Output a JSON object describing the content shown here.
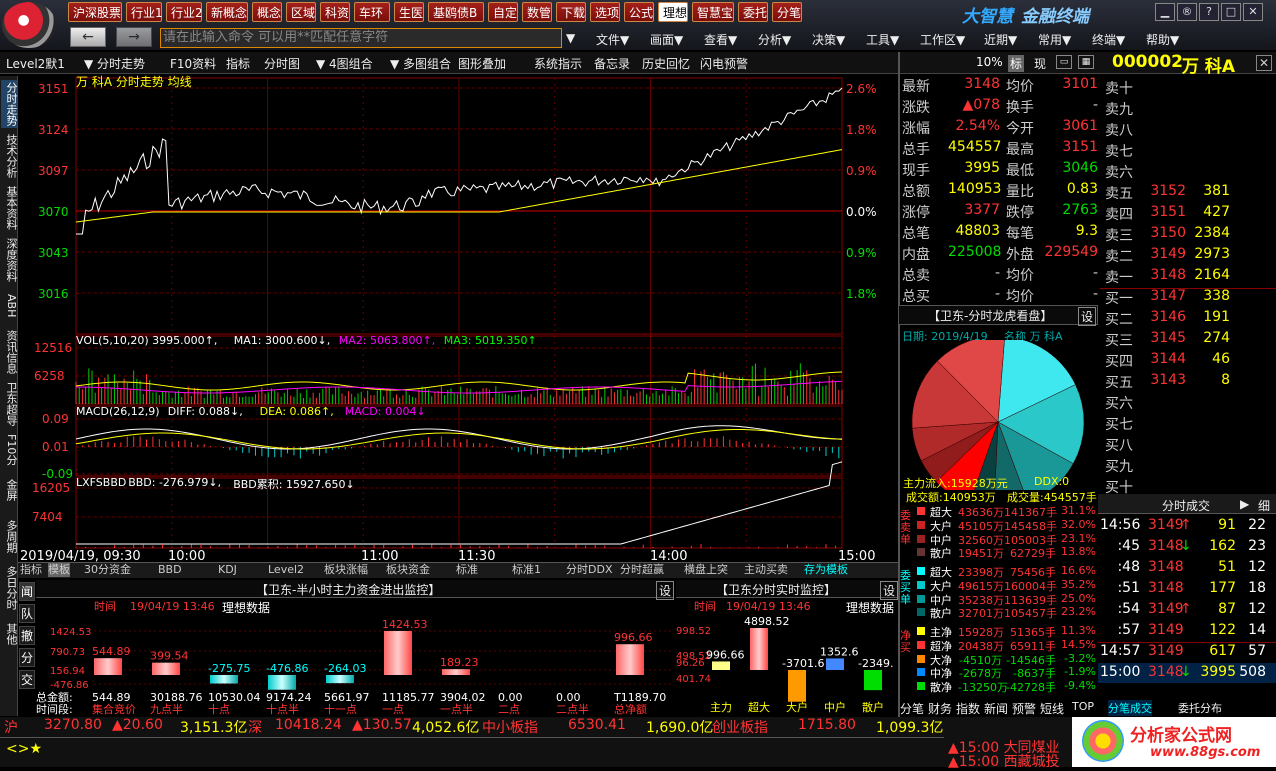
{
  "menu": {
    "tabs": [
      "沪深股票",
      "行业1",
      "行业2",
      "新概念",
      "概念",
      "区域",
      "科资",
      "车环",
      "生医",
      "基鸥债B",
      "自定",
      "数管",
      "下载",
      "选项",
      "公式",
      "理想",
      "智慧宝",
      "委托",
      "分笔"
    ],
    "selected": "理想",
    "brand": "大智慧",
    "brand2": "金融终端",
    "cmd_placeholder": "请在此输入命令   可以用**匹配任意字符",
    "menu2": [
      "文件▼",
      "画面▼",
      "查看▼",
      "分析▼",
      "决策▼",
      "工具▼",
      "工作区▼",
      "近期▼",
      "常用▼",
      "终端▼",
      "帮助▼"
    ],
    "back": "←",
    "fwd": "→"
  },
  "toolbar": [
    "Level2默1",
    "▼ 分时走势",
    "F10资料",
    "指标",
    "分时图",
    "▼ 4图组合",
    "▼ 多图组合",
    "图形叠加",
    "系统指示",
    "备忘录",
    "历史回忆",
    "闪电预警"
  ],
  "toolbar_right": {
    "pct": "10%",
    "a": "标",
    "b": "现"
  },
  "vtabs": [
    "分时走势",
    "技术分析",
    "基本资料",
    "深度资料",
    "ABH",
    "资讯信息",
    "卫东超导",
    "F10分",
    "金屏",
    "多周期",
    "多日分时",
    "其他"
  ],
  "chart": {
    "title": "万 科A 分时走势 均线",
    "y_left": [
      "3151",
      "3124",
      "3097",
      "3070",
      "3043",
      "3016"
    ],
    "y_right": [
      "2.6%",
      "1.8%",
      "0.9%",
      "0.0%",
      "0.9%",
      "1.8%"
    ],
    "vol_header": {
      "a": "VOL(5,10,20) 3995.000↑,",
      "b": "MA1: 3000.600↓,",
      "c": "MA2: 5063.800↑,",
      "d": "MA3: 5019.350↑"
    },
    "vol_y": [
      "12516",
      "6258"
    ],
    "macd_header": {
      "a": "MACD(26,12,9)",
      "b": "DIFF: 0.088↓,",
      "c": "DEA: 0.086↑,",
      "d": "MACD: 0.004↓"
    },
    "macd_y": [
      "0.09",
      "0.01",
      "-0.09"
    ],
    "lxf_header": {
      "a": "LXFSBBD",
      "b": "BBD: -276.979↓,",
      "c": "BBD累积: 15927.650↓"
    },
    "lxf_y": [
      "16205",
      "7404"
    ],
    "xtimes": [
      "2019/04/19, 09:30",
      "10:00",
      "11:00",
      "11:30",
      "14:00",
      "15:00"
    ]
  },
  "quote": {
    "code": "000002",
    "name": "万 科A",
    "rows": [
      [
        "最新",
        "3148",
        "均价",
        "3101"
      ],
      [
        "涨跌",
        "▲078",
        "换手",
        "-"
      ],
      [
        "涨幅",
        "2.54%",
        "今开",
        "3061"
      ],
      [
        "总手",
        "454557",
        "最高",
        "3151"
      ],
      [
        "现手",
        "3995",
        "最低",
        "3046"
      ],
      [
        "总额",
        "140953",
        "量比",
        "0.83"
      ],
      [
        "涨停",
        "3377",
        "跌停",
        "2763"
      ],
      [
        "总笔",
        "48803",
        "每笔",
        "9.3"
      ],
      [
        "内盘",
        "225008",
        "外盘",
        "229549"
      ],
      [
        "总卖",
        "-",
        "均价",
        "-"
      ],
      [
        "总买",
        "-",
        "均价",
        "-"
      ]
    ],
    "sells": [
      [
        "卖十",
        "",
        ""
      ],
      [
        "卖九",
        "",
        ""
      ],
      [
        "卖八",
        "",
        ""
      ],
      [
        "卖七",
        "",
        ""
      ],
      [
        "卖六",
        "",
        ""
      ],
      [
        "卖五",
        "3152",
        "381"
      ],
      [
        "卖四",
        "3151",
        "427"
      ],
      [
        "卖三",
        "3150",
        "2384"
      ],
      [
        "卖二",
        "3149",
        "2973"
      ],
      [
        "卖一",
        "3148",
        "2164"
      ]
    ],
    "buys": [
      [
        "买一",
        "3147",
        "338"
      ],
      [
        "买二",
        "3146",
        "191"
      ],
      [
        "买三",
        "3145",
        "274"
      ],
      [
        "买四",
        "3144",
        "46"
      ],
      [
        "买五",
        "3143",
        "8"
      ],
      [
        "买六",
        "",
        ""
      ],
      [
        "买七",
        "",
        ""
      ],
      [
        "买八",
        "",
        ""
      ],
      [
        "买九",
        "",
        ""
      ],
      [
        "买十",
        "",
        ""
      ]
    ]
  },
  "pie": {
    "header": "【卫东-分时龙虎看盘】",
    "set": "设",
    "date": "日期: 2019/4/19",
    "name": "名称 万 科A",
    "flow": "主力流入:15928万元",
    "ddx": "DDX:0",
    "amount": "成交额:140953万",
    "volume": "成交量:454557手",
    "slices": [
      {
        "v": 16.6,
        "c": "#3ee8ee"
      },
      {
        "v": 15.2,
        "c": "#2ac8c8"
      },
      {
        "v": 11.3,
        "c": "#1a9898"
      },
      {
        "v": 6.4,
        "c": "#136868"
      },
      {
        "v": 4.6,
        "c": "#0a4040"
      },
      {
        "v": 7.4,
        "c": "#f00"
      },
      {
        "v": 4.8,
        "c": "#901c1c"
      },
      {
        "v": 6.3,
        "c": "#b02a2a"
      },
      {
        "v": 13.7,
        "c": "#c83838"
      },
      {
        "v": 13.7,
        "c": "#e04848"
      }
    ]
  },
  "flows": {
    "sell_label": "委卖单",
    "buy_label": "委买单",
    "net_label": "净买",
    "rows_sell": [
      [
        "超大",
        "43636万",
        "141367手",
        "31.1%"
      ],
      [
        "大户",
        "45105万",
        "145458手",
        "32.0%"
      ],
      [
        "中户",
        "32560万",
        "105003手",
        "23.1%"
      ],
      [
        "散户",
        "19451万",
        "62729手",
        "13.8%"
      ]
    ],
    "rows_buy": [
      [
        "超大",
        "23398万",
        "75456手",
        "16.6%"
      ],
      [
        "大户",
        "49615万",
        "160004手",
        "35.2%"
      ],
      [
        "中户",
        "35238万",
        "113639手",
        "25.0%"
      ],
      [
        "散户",
        "32701万",
        "105457手",
        "23.2%"
      ]
    ],
    "rows_net": [
      [
        "主净",
        "15928万",
        "51365手",
        "11.3%"
      ],
      [
        "超净",
        "20438万",
        "65911手",
        "14.5%"
      ],
      [
        "大净",
        "-4510万",
        "-14546手",
        "-3.2%"
      ],
      [
        "中净",
        "-2678万",
        "-8637手",
        "-1.9%"
      ],
      [
        "散净",
        "-13250万",
        "-42728手",
        "-9.4%"
      ]
    ]
  },
  "ticks": {
    "header": "分时成交",
    "btn": "细",
    "rows": [
      [
        "14:56",
        "3149",
        "↑",
        "91",
        "22"
      ],
      [
        ":45",
        "3148",
        "↓",
        "162",
        "23"
      ],
      [
        ":48",
        "3148",
        "",
        "51",
        "12"
      ],
      [
        ":51",
        "3148",
        "",
        "177",
        "18"
      ],
      [
        ":54",
        "3149",
        "↑",
        "87",
        "12"
      ],
      [
        ":57",
        "3149",
        "",
        "122",
        "14"
      ],
      [
        "14:57",
        "3149",
        "",
        "617",
        "57"
      ],
      [
        "15:00",
        "3148",
        "↓",
        "3995",
        "508"
      ]
    ]
  },
  "btabs": [
    "指标",
    "模板",
    "30分资金",
    "BBD",
    "KDJ",
    "Level2",
    "板块涨幅",
    "板块资金",
    "标准",
    "标准1",
    "分时DDX",
    "分时超赢",
    "横盘上突",
    "主动买卖",
    "存为模板"
  ],
  "panelA": {
    "title": "【卫东-半小时主力资金进出监控】",
    "set": "设",
    "time": "时间",
    "date": "19/04/19 13:46",
    "ideal": "理想数据",
    "y": [
      "1424.53",
      "790.73",
      "156.94",
      "-476.86"
    ],
    "bars": [
      {
        "v": 544.89,
        "top": "544.89",
        "cap": "544.89",
        "lab": "集合竞价"
      },
      {
        "v": 399.54,
        "top": "399.54",
        "cap": "30188.76",
        "lab": "九点半"
      },
      {
        "v": -275.75,
        "top": "-275.75",
        "cap": "10530.04",
        "lab": "十点"
      },
      {
        "v": -476.86,
        "top": "-476.86",
        "cap": "9174.24",
        "lab": "十点半"
      },
      {
        "v": -264.03,
        "top": "-264.03",
        "cap": "5661.97",
        "lab": "十一点"
      },
      {
        "v": 1424.53,
        "top": "1424.53",
        "cap": "11185.77",
        "lab": "一点"
      },
      {
        "v": 189.23,
        "top": "189.23",
        "cap": "3904.02",
        "lab": "一点半"
      },
      {
        "v": 0,
        "top": "",
        "cap": "0.00",
        "lab": "二点"
      },
      {
        "v": 0,
        "top": "",
        "cap": "0.00",
        "lab": "二点半"
      },
      {
        "v": 996.66,
        "top": "996.66",
        "cap": "T1189.70",
        "lab": "总净额"
      }
    ],
    "row1": "总金额:",
    "row2": "时间段:",
    "left_tabs": [
      "闻",
      "队",
      "撤",
      "分",
      "交"
    ]
  },
  "panelB": {
    "title": "【卫东分时实时监控】",
    "set": "设",
    "time": "时间",
    "date": "19/04/19 13:46",
    "ideal": "理想数据",
    "y": [
      "998.52",
      "498.52",
      "96.26",
      "401.74"
    ],
    "bars": [
      {
        "v": 996.66,
        "lab": "主力",
        "t": "996.66"
      },
      {
        "v": 4898.52,
        "lab": "超大",
        "t": "4898.52"
      },
      {
        "v": -3701.6,
        "lab": "大户",
        "t": "-3701.6"
      },
      {
        "v": 1352.6,
        "lab": "中户",
        "t": "1352.6"
      },
      {
        "v": -2349.2,
        "lab": "散户",
        "t": "-2349."
      }
    ]
  },
  "rtabs": [
    "分笔",
    "财务",
    "指数",
    "新闻",
    "预警",
    "短线"
  ],
  "rtabs2": [
    "TOP",
    "分笔成交",
    "委托分布"
  ],
  "status": {
    "sh": "沪",
    "sh_v": "3270.80",
    "sh_c": "▲20.60",
    "sh_a": "3,151.3亿",
    "sz": "深",
    "sz_v": "10418.24",
    "sz_c": "▲130.57",
    "sz_a": "4,052.6亿",
    "zx": "中小板指",
    "zx_v": "6530.41",
    "zx_a": "1,690.0亿",
    "cy": "创业板指",
    "cy_v": "1715.80",
    "cy_a": "1,099.3亿",
    "news1": "▲15:00 大同煤业",
    "news2": "▲15:00 西藏城投",
    "site": "分析家公式网",
    "site2": "www.88gs.com",
    "icons": "<>★"
  }
}
